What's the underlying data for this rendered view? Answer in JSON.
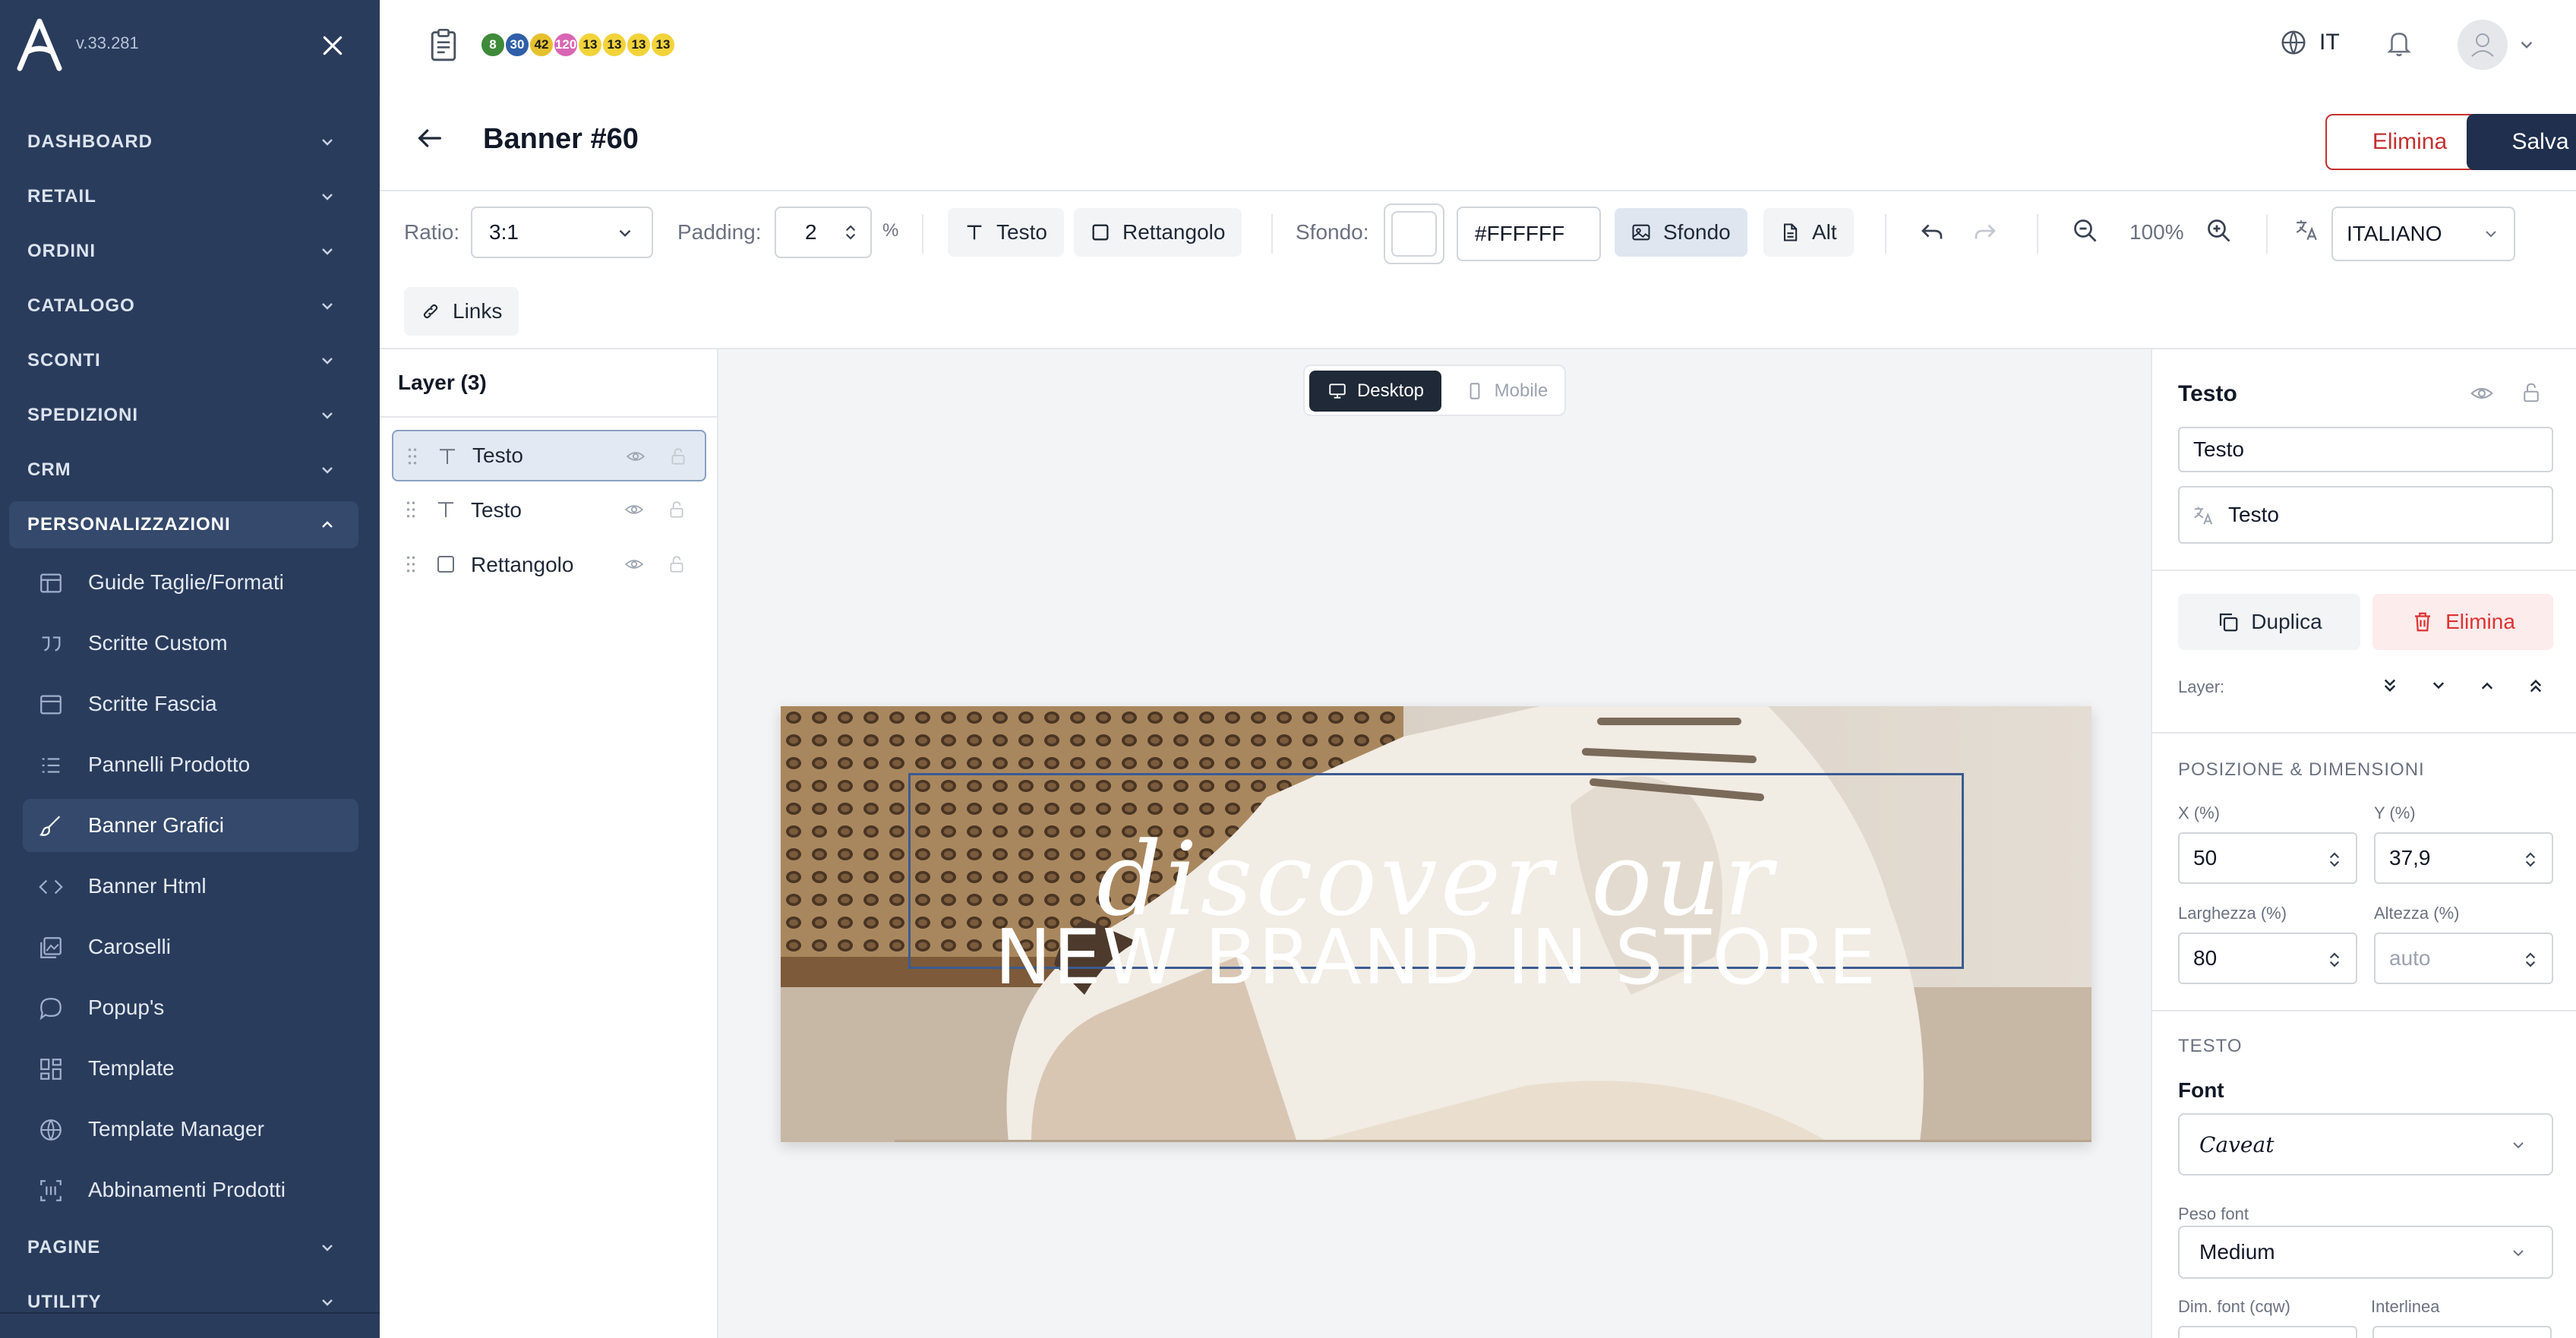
{
  "sidebar": {
    "version": "v.33.281",
    "sections": [
      {
        "label": "DASHBOARD"
      },
      {
        "label": "RETAIL"
      },
      {
        "label": "ORDINI"
      },
      {
        "label": "CATALOGO"
      },
      {
        "label": "SCONTI"
      },
      {
        "label": "SPEDIZIONI"
      },
      {
        "label": "CRM"
      },
      {
        "label": "PERSONALIZZAZIONI"
      },
      {
        "label": "PAGINE"
      },
      {
        "label": "UTILITY"
      }
    ],
    "sub_items": [
      {
        "label": "Guide Taglie/Formati",
        "icon": "table-icon"
      },
      {
        "label": "Scritte Custom",
        "icon": "quote-icon"
      },
      {
        "label": "Scritte Fascia",
        "icon": "window-icon"
      },
      {
        "label": "Pannelli Prodotto",
        "icon": "list-icon"
      },
      {
        "label": "Banner Grafici",
        "icon": "brush-icon"
      },
      {
        "label": "Banner Html",
        "icon": "code-icon"
      },
      {
        "label": "Caroselli",
        "icon": "images-icon"
      },
      {
        "label": "Popup's",
        "icon": "message-icon"
      },
      {
        "label": "Template",
        "icon": "layout-icon"
      },
      {
        "label": "Template Manager",
        "icon": "globe-icon"
      },
      {
        "label": "Abbinamenti Prodotti",
        "icon": "scan-icon"
      }
    ]
  },
  "topbar": {
    "badges": [
      {
        "value": "8",
        "color": "#3f8a3a"
      },
      {
        "value": "30",
        "color": "#2f5fa8"
      },
      {
        "value": "42",
        "color": "#e6c12e"
      },
      {
        "value": "120",
        "color": "#d966b3"
      },
      {
        "value": "13",
        "color": "#f2d33a"
      },
      {
        "value": "13",
        "color": "#f2d33a"
      },
      {
        "value": "13",
        "color": "#f2d33a"
      },
      {
        "value": "13",
        "color": "#f2d33a"
      }
    ],
    "language": "IT"
  },
  "header": {
    "title": "Banner #60",
    "delete_label": "Elimina",
    "save_label": "Salva"
  },
  "toolbar": {
    "ratio_label": "Ratio:",
    "ratio_value": "3:1",
    "padding_label": "Padding:",
    "padding_value": "2",
    "padding_unit": "%",
    "add_text_label": "Testo",
    "add_rect_label": "Rettangolo",
    "bg_label": "Sfondo:",
    "bg_color": "#FFFFFF",
    "bg_button_label": "Sfondo",
    "alt_label": "Alt",
    "zoom_value": "100%",
    "language_value": "ITALIANO",
    "links_label": "Links"
  },
  "layers": {
    "title": "Layer (3)",
    "items": [
      {
        "name": "Testo",
        "type": "text"
      },
      {
        "name": "Testo",
        "type": "text"
      },
      {
        "name": "Rettangolo",
        "type": "rect"
      }
    ]
  },
  "canvas": {
    "desktop_label": "Desktop",
    "mobile_label": "Mobile",
    "banner_script": "discover our",
    "banner_headline": "NEW BRAND IN STORE"
  },
  "props": {
    "title": "Testo",
    "text_value": "Testo",
    "translation_value": "Testo",
    "duplicate_label": "Duplica",
    "delete_label": "Elimina",
    "layer_label": "Layer:",
    "pos_section": "POSIZIONE & DIMENSIONI",
    "x_label": "X (%)",
    "x_value": "50",
    "y_label": "Y (%)",
    "y_value": "37,9",
    "width_label": "Larghezza (%)",
    "width_value": "80",
    "height_label": "Altezza (%)",
    "height_placeholder": "auto",
    "text_section": "TESTO",
    "font_label": "Font",
    "font_value": "Caveat",
    "weight_label": "Peso font",
    "weight_value": "Medium",
    "size_label": "Dim. font (cqw)",
    "line_height_label": "Interlinea"
  }
}
